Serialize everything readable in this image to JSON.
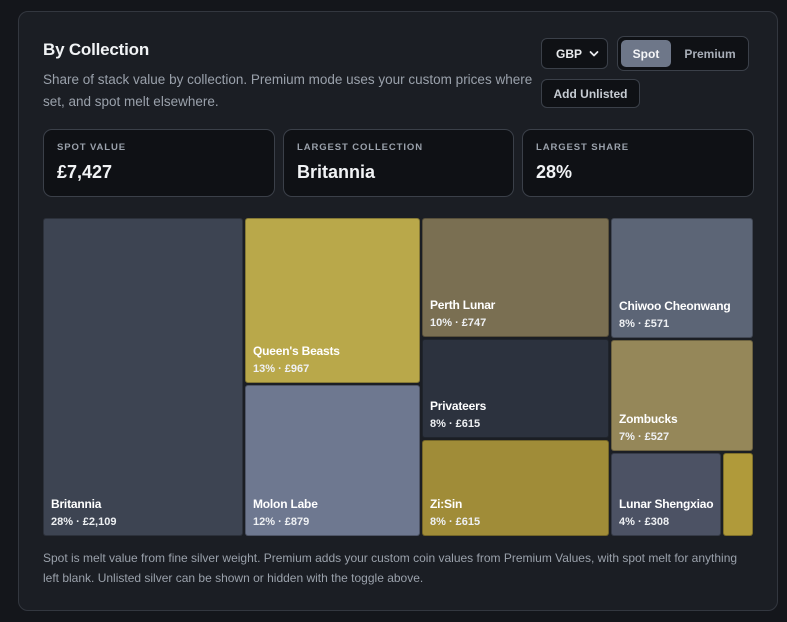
{
  "header": {
    "title": "By Collection",
    "subtitle": "Share of stack value by collection. Premium mode uses your custom prices where set, and spot melt elsewhere."
  },
  "controls": {
    "currency": "GBP",
    "mode_options": [
      "Spot",
      "Premium"
    ],
    "active_mode": "Spot",
    "add_unlisted_label": "Add Unlisted"
  },
  "stats": [
    {
      "label": "SPOT VALUE",
      "value": "£7,427"
    },
    {
      "label": "LARGEST COLLECTION",
      "value": "Britannia"
    },
    {
      "label": "LARGEST SHARE",
      "value": "28%"
    }
  ],
  "colors": {
    "slate_dark": "#3d4452",
    "gold_bright": "#b9a84a",
    "periwinkle": "#6e7890",
    "olive_brown": "#7a6f52",
    "navy": "#2c323e",
    "mustard": "#a08c38",
    "steel": "#5c6576",
    "khaki": "#958759",
    "charcoal_blue": "#4c5264",
    "gold_small": "#b09a3a"
  },
  "chart_data": {
    "type": "treemap",
    "currency": "GBP",
    "items": [
      {
        "name": "Britannia",
        "meta": "28% · £2,109",
        "share": 28,
        "value": 2109,
        "color": "#3d4452"
      },
      {
        "name": "Queen's Beasts",
        "meta": "13% · £967",
        "share": 13,
        "value": 967,
        "color": "#b9a84a"
      },
      {
        "name": "Molon Labe",
        "meta": "12% · £879",
        "share": 12,
        "value": 879,
        "color": "#6e7890"
      },
      {
        "name": "Perth Lunar",
        "meta": "10% · £747",
        "share": 10,
        "value": 747,
        "color": "#7a6f52"
      },
      {
        "name": "Privateers",
        "meta": "8% · £615",
        "share": 8,
        "value": 615,
        "color": "#2c323e"
      },
      {
        "name": "Zi:Sin",
        "meta": "8% · £615",
        "share": 8,
        "value": 615,
        "color": "#a08c38"
      },
      {
        "name": "Chiwoo Cheonwang",
        "meta": "8% · £571",
        "share": 8,
        "value": 571,
        "color": "#5c6576"
      },
      {
        "name": "Zombucks",
        "meta": "7% · £527",
        "share": 7,
        "value": 527,
        "color": "#958759"
      },
      {
        "name": "Lunar Shengxiao",
        "meta": "4% · £308",
        "share": 4,
        "value": 308,
        "color": "#4c5264"
      },
      {
        "name": "",
        "meta": "",
        "color": "#b09a3a"
      }
    ]
  },
  "footnote": "Spot is melt value from fine silver weight. Premium adds your custom coin values from Premium Values, with spot melt for anything left blank. Unlisted silver can be shown or hidden with the toggle above."
}
